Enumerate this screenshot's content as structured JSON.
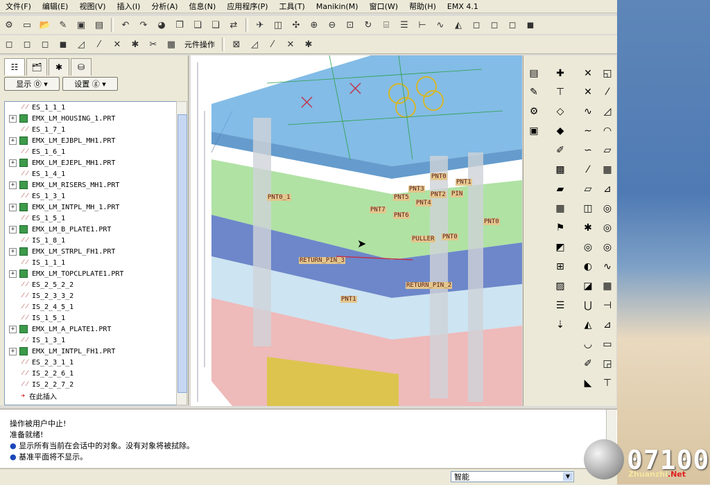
{
  "menu": [
    "文件(F)",
    "编辑(E)",
    "视图(V)",
    "插入(I)",
    "分析(A)",
    "信息(N)",
    "应用程序(P)",
    "工具(T)",
    "Manikin(M)",
    "窗口(W)",
    "帮助(H)",
    "EMX 4.1"
  ],
  "toolbar2": {
    "component_ops_label": "元件操作"
  },
  "panel": {
    "tabs": [
      "model-tree",
      "folder",
      "favorites",
      "layers"
    ],
    "show_button": "显示 ⓪ ▾",
    "settings_button": "设置 ⓖ ▾"
  },
  "tree": [
    {
      "label": "ES_1_1_1",
      "type": "feature",
      "expandable": false
    },
    {
      "label": "EMX_LM_HOUSING_1.PRT",
      "type": "part",
      "expandable": true
    },
    {
      "label": "ES_1_7_1",
      "type": "feature",
      "expandable": false
    },
    {
      "label": "EMX_LM_EJBPL_MH1.PRT",
      "type": "part",
      "expandable": true
    },
    {
      "label": "ES_1_6_1",
      "type": "feature",
      "expandable": false
    },
    {
      "label": "EMX_LM_EJEPL_MH1.PRT",
      "type": "part",
      "expandable": true
    },
    {
      "label": "ES_1_4_1",
      "type": "feature",
      "expandable": false
    },
    {
      "label": "EMX_LM_RISERS_MH1.PRT",
      "type": "part",
      "expandable": true
    },
    {
      "label": "ES_1_3_1",
      "type": "feature",
      "expandable": false
    },
    {
      "label": "EMX_LM_INTPL_MH_1.PRT",
      "type": "part",
      "expandable": true
    },
    {
      "label": "ES_1_5_1",
      "type": "feature",
      "expandable": false
    },
    {
      "label": "EMX_LM_B_PLATE1.PRT",
      "type": "part",
      "expandable": true
    },
    {
      "label": "IS_1_8_1",
      "type": "feature",
      "expandable": false
    },
    {
      "label": "EMX_LM_STRPL_FH1.PRT",
      "type": "part",
      "expandable": true
    },
    {
      "label": "IS_1_1_1",
      "type": "feature",
      "expandable": false
    },
    {
      "label": "EMX_LM_TOPCLPLATE1.PRT",
      "type": "part",
      "expandable": true
    },
    {
      "label": "ES_2_5_2_2",
      "type": "feature",
      "expandable": false
    },
    {
      "label": "IS_2_3_3_2",
      "type": "feature",
      "expandable": false
    },
    {
      "label": "IS_2_4_5_1",
      "type": "feature",
      "expandable": false
    },
    {
      "label": "IS_1_5_1",
      "type": "feature",
      "expandable": false
    },
    {
      "label": "EMX_LM_A_PLATE1.PRT",
      "type": "part",
      "expandable": true
    },
    {
      "label": "IS_1_3_1",
      "type": "feature",
      "expandable": false
    },
    {
      "label": "EMX_LM_INTPL_FH1.PRT",
      "type": "part",
      "expandable": true
    },
    {
      "label": "ES_2_3_1_1",
      "type": "feature",
      "expandable": false
    },
    {
      "label": "IS_2_2_6_1",
      "type": "feature",
      "expandable": false
    },
    {
      "label": "IS_2_2_7_2",
      "type": "feature",
      "expandable": false
    },
    {
      "label": "在此插入",
      "type": "insert",
      "expandable": false
    }
  ],
  "datum_labels": [
    "PNT0_1",
    "PNT0",
    "PNT1",
    "PNT3",
    "PNT5",
    "PNT2",
    "PIN",
    "PNT4",
    "PNT7",
    "PNT6",
    "PNT0",
    "PULLER",
    "PNT0",
    "RETURN_PIN_3",
    "RETURN_PIN_2",
    "PNT1"
  ],
  "messages": [
    {
      "bullet": false,
      "text": "操作被用户中止!"
    },
    {
      "bullet": false,
      "text": "准备就绪!"
    },
    {
      "bullet": true,
      "text": "显示所有当前在会话中的对象。没有对象将被拭除。"
    },
    {
      "bullet": true,
      "text": "基准平面将不显示。"
    }
  ],
  "status": {
    "filter_value": "智能"
  },
  "watermark": {
    "number": "07100",
    "site_a": "Zhuanzhi",
    "site_b": ".Net"
  },
  "colors": {
    "chrome": "#ece9d8",
    "tree_border": "#7f9db9",
    "plate_blue": "#5aa6dd",
    "plate_green": "#8fd67e",
    "plate_navy": "#3c5fb8",
    "plate_red": "#e8a3a3",
    "plate_yellow": "#d9c63b"
  }
}
